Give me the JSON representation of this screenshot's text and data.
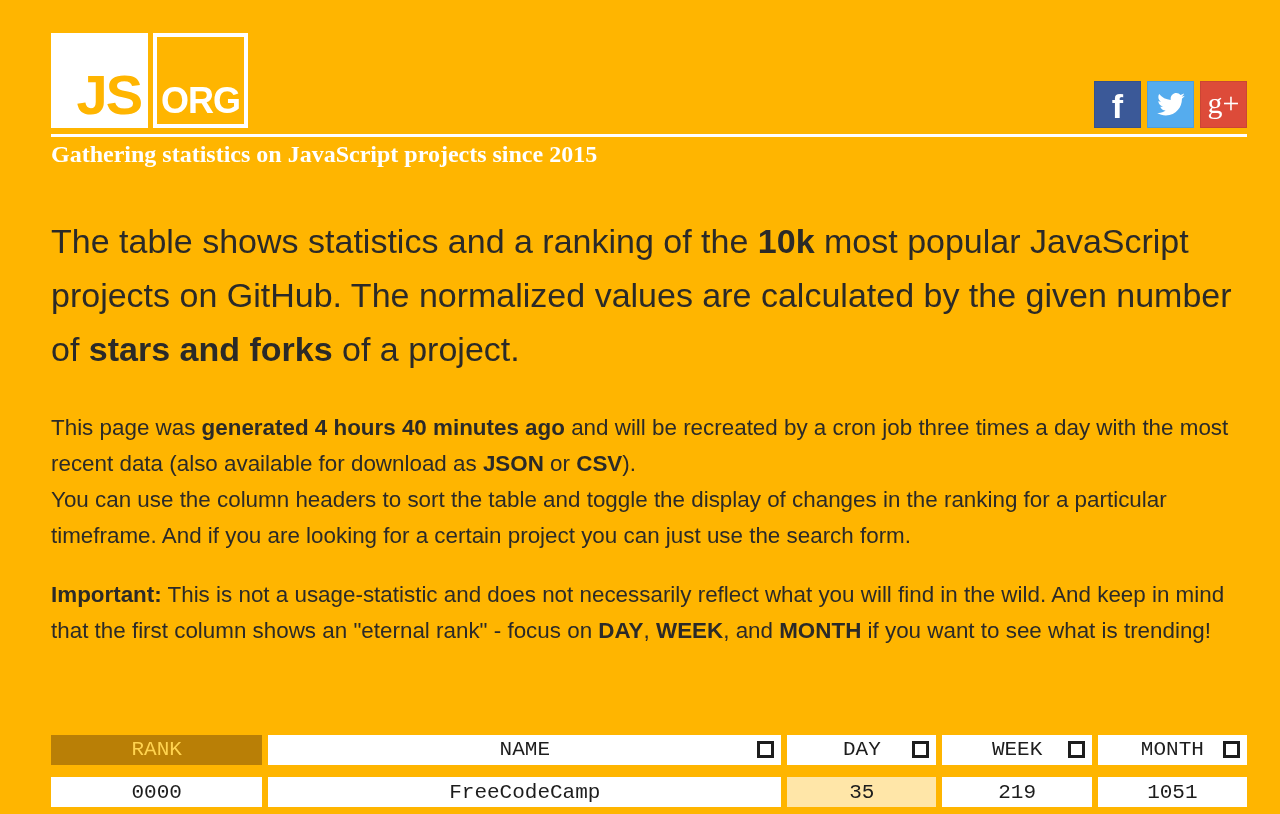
{
  "header": {
    "logo": {
      "primary": "JS",
      "secondary": "ORG"
    },
    "tagline": "Gathering statistics on JavaScript projects since 2015",
    "social_links": [
      {
        "kind": "facebook",
        "glyph": "f"
      },
      {
        "kind": "twitter"
      },
      {
        "kind": "google-plus",
        "glyph": "g+"
      }
    ]
  },
  "intro": {
    "lead": "The table shows statistics and a ranking of the **10k** most popular JavaScript projects on GitHub. The normalized values are calculated by the given number of **stars and forks** of a project.",
    "paragraphs": [
      [
        "This page was **generated 4 hours 40 minutes ago** and will be recreated by a cron job three times a day with the most recent data (also available for download as **JSON** or **CSV**).",
        "You can use the column headers to sort the table and toggle the display of changes in the ranking for a particular timeframe. And if you are looking for a certain project you can just use the search form."
      ],
      [
        "**Important:** This is not a usage-statistic and does not necessarily reflect what you will find in the wild. And keep in mind that the first column shows an \"eternal rank\" - focus on **DAY**, **WEEK**, and **MONTH** if you want to see what is trending!"
      ]
    ]
  },
  "table": {
    "columns": [
      {
        "label": "RANK",
        "selected": true
      },
      {
        "label": "NAME",
        "selected": false,
        "checked": false
      },
      {
        "label": "DAY",
        "selected": false,
        "checked": false
      },
      {
        "label": "WEEK",
        "selected": false,
        "checked": false
      },
      {
        "label": "MONTH",
        "selected": false,
        "checked": false
      }
    ],
    "rows": [
      {
        "cells": [
          {
            "text": "0000",
            "highlighted": false
          },
          {
            "text": "FreeCodeCamp",
            "highlighted": false
          },
          {
            "text": "35",
            "highlighted": true
          },
          {
            "text": "219",
            "highlighted": false
          },
          {
            "text": "1051",
            "highlighted": false
          }
        ]
      }
    ]
  }
}
